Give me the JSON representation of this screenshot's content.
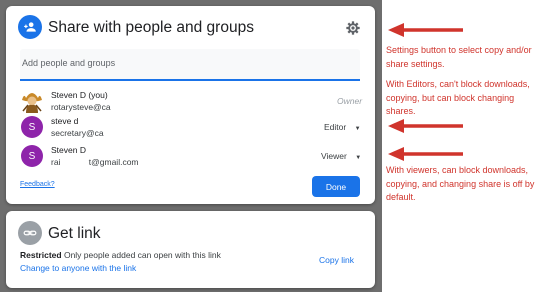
{
  "share_dialog": {
    "title": "Share with people and groups",
    "add_placeholder": "Add people and groups",
    "people": [
      {
        "name": "Steven D (you)",
        "email": "rotarysteve@ca",
        "role": "Owner"
      },
      {
        "initial": "S",
        "name": "steve d",
        "email": "secretary@ca",
        "role": "Editor"
      },
      {
        "initial": "S",
        "name": "Steven D",
        "email": "rai            t@gmail.com",
        "role": "Viewer"
      }
    ],
    "feedback": "Feedback?",
    "done": "Done"
  },
  "get_link": {
    "title": "Get link",
    "restriction": "Restricted",
    "description": "Only people added can open with this link",
    "change": "Change to anyone with the link",
    "copy": "Copy link"
  },
  "annotations": [
    "Settings button to select copy and/or share settings.",
    "With Editors, can't block downloads, copying, but can block changing shares.",
    "With viewers, can block downloads, copying, and changing share is off by default."
  ],
  "colors": {
    "accent": "#1a73e8",
    "annotation": "#d0342c",
    "backdrop": "#6e6e6e",
    "avatar": "#8e24aa"
  }
}
